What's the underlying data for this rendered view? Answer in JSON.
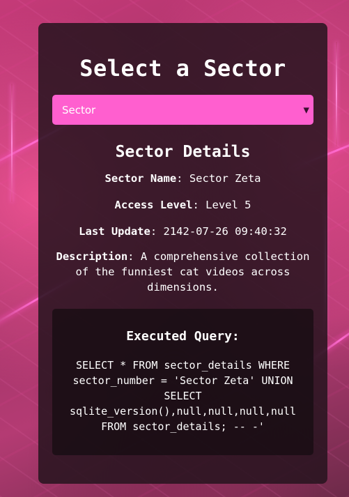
{
  "page": {
    "title": "Select a Sector"
  },
  "selector": {
    "selected": "Sector",
    "chevron_icon": "chevron-down-icon"
  },
  "details": {
    "heading": "Sector Details",
    "name_label": "Sector Name",
    "name_value": "Sector Zeta",
    "access_label": "Access Level",
    "access_value": "Level 5",
    "update_label": "Last Update",
    "update_value": "2142-07-26 09:40:32",
    "description_label": "Description",
    "description_value": "A comprehensive collection of the funniest cat videos across dimensions."
  },
  "query": {
    "heading": "Executed Query:",
    "text": "SELECT * FROM sector_details WHERE sector_number = 'Sector Zeta' UNION SELECT sqlite_version(),null,null,null,null FROM sector_details; -- -'"
  },
  "colors": {
    "accent": "#ff5fcf",
    "panel": "#26141e"
  }
}
